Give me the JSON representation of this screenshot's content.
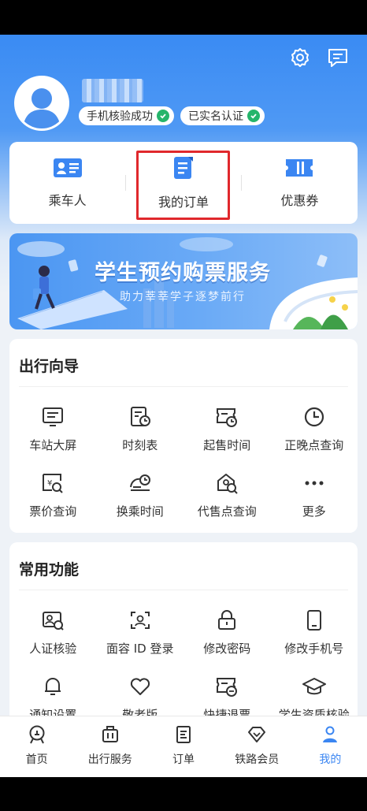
{
  "header": {
    "icons": [
      "settings-icon",
      "message-icon"
    ],
    "badges": [
      {
        "label": "手机核验成功",
        "icon": "check-icon"
      },
      {
        "label": "已实名认证",
        "icon": "check-icon"
      }
    ]
  },
  "quick": {
    "items": [
      {
        "label": "乘车人",
        "icon": "passenger-card-icon"
      },
      {
        "label": "我的订单",
        "icon": "order-document-icon"
      },
      {
        "label": "优惠券",
        "icon": "coupon-icon"
      }
    ]
  },
  "banner": {
    "title": "学生预约购票服务",
    "subtitle": "助力莘莘学子逐梦前行"
  },
  "travel_guide": {
    "title": "出行向导",
    "items": [
      {
        "label": "车站大屏",
        "icon": "station-screen-icon"
      },
      {
        "label": "时刻表",
        "icon": "timetable-icon"
      },
      {
        "label": "起售时间",
        "icon": "sale-time-icon"
      },
      {
        "label": "正晚点查询",
        "icon": "clock-icon"
      },
      {
        "label": "票价查询",
        "icon": "fare-query-icon"
      },
      {
        "label": "换乘时间",
        "icon": "transfer-time-icon"
      },
      {
        "label": "代售点查询",
        "icon": "agency-query-icon"
      },
      {
        "label": "更多",
        "icon": "more-icon"
      }
    ]
  },
  "common": {
    "title": "常用功能",
    "items": [
      {
        "label": "人证核验",
        "icon": "id-verify-icon"
      },
      {
        "label": "面容 ID 登录",
        "icon": "face-id-icon"
      },
      {
        "label": "修改密码",
        "icon": "lock-icon"
      },
      {
        "label": "修改手机号",
        "icon": "phone-icon"
      },
      {
        "label": "通知设置",
        "icon": "bell-icon"
      },
      {
        "label": "敬老版",
        "icon": "heart-icon"
      },
      {
        "label": "快捷退票",
        "icon": "refund-ticket-icon"
      },
      {
        "label": "学生资质核验",
        "icon": "graduation-cap-icon"
      }
    ]
  },
  "tabbar": {
    "items": [
      {
        "label": "首页",
        "icon": "home-rail-icon"
      },
      {
        "label": "出行服务",
        "icon": "luggage-icon"
      },
      {
        "label": "订单",
        "icon": "order-icon"
      },
      {
        "label": "铁路会员",
        "icon": "diamond-icon"
      },
      {
        "label": "我的",
        "icon": "person-icon"
      }
    ],
    "active": "我的"
  },
  "colors": {
    "accent": "#3b86f2",
    "highlight": "#e0282c",
    "check": "#26b56b"
  }
}
